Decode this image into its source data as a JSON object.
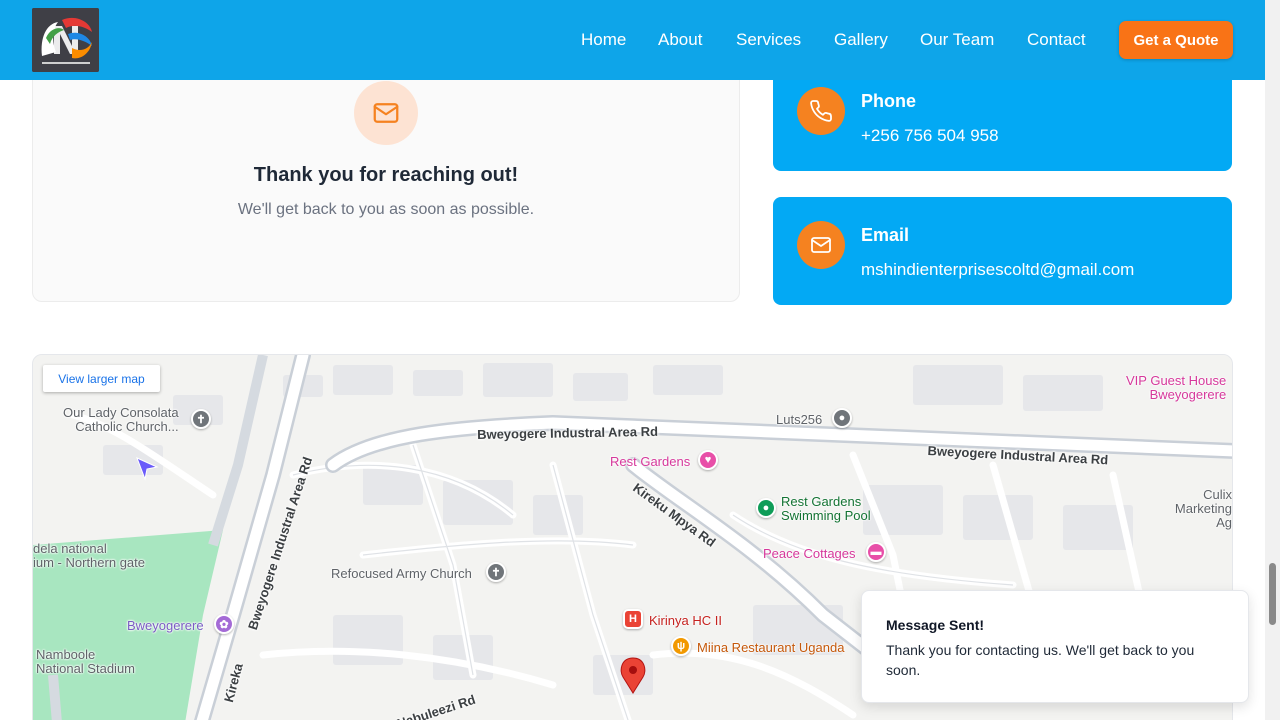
{
  "header": {
    "logo_alt": "Mshindi Enterprises logo",
    "nav": [
      {
        "label": "Home"
      },
      {
        "label": "About"
      },
      {
        "label": "Services"
      },
      {
        "label": "Gallery"
      },
      {
        "label": "Our Team"
      },
      {
        "label": "Contact"
      }
    ],
    "cta_label": "Get a Quote"
  },
  "thanks": {
    "icon": "mail-icon",
    "title": "Thank you for reaching out!",
    "subtitle": "We'll get back to you as soon as possible."
  },
  "contact_cards": [
    {
      "icon": "phone-icon",
      "title": "Phone",
      "value": "+256 756 504 958"
    },
    {
      "icon": "mail-icon",
      "title": "Email",
      "value": "mshindienterprisescoltd@gmail.com"
    }
  ],
  "map": {
    "larger_map_label": "View larger map",
    "roads": [
      "Bweyogere Industral Area Rd",
      "Bweyogere Industral Area Rd",
      "Bweyogere Industral Area Rd",
      "Kireku Mpya Rd",
      "Kireka",
      "Nabuleezi Rd"
    ],
    "places": {
      "our_lady": "Our Lady Consolata\nCatholic Church...",
      "luts": "Luts256",
      "rest_gardens": "Rest Gardens",
      "rest_gardens_pool": "Rest Gardens\nSwimming Pool",
      "vip_guest_house": "VIP Guest House\nBweyogerere",
      "culix": "Culix\nMarketing Ag",
      "peace_cottages": "Peace Cottages",
      "refocused_church": "Refocused Army Church",
      "namboole_gate": "dela national\nium - Northern gate",
      "bweyogerere": "Bweyogerere",
      "namboole": "Namboole\nNational Stadium",
      "kirinya": "Kirinya HC II",
      "miina": "Miina Restaurant Uganda"
    }
  },
  "toast": {
    "title": "Message Sent!",
    "message": "Thank you for contacting us. We'll get back to you soon."
  }
}
